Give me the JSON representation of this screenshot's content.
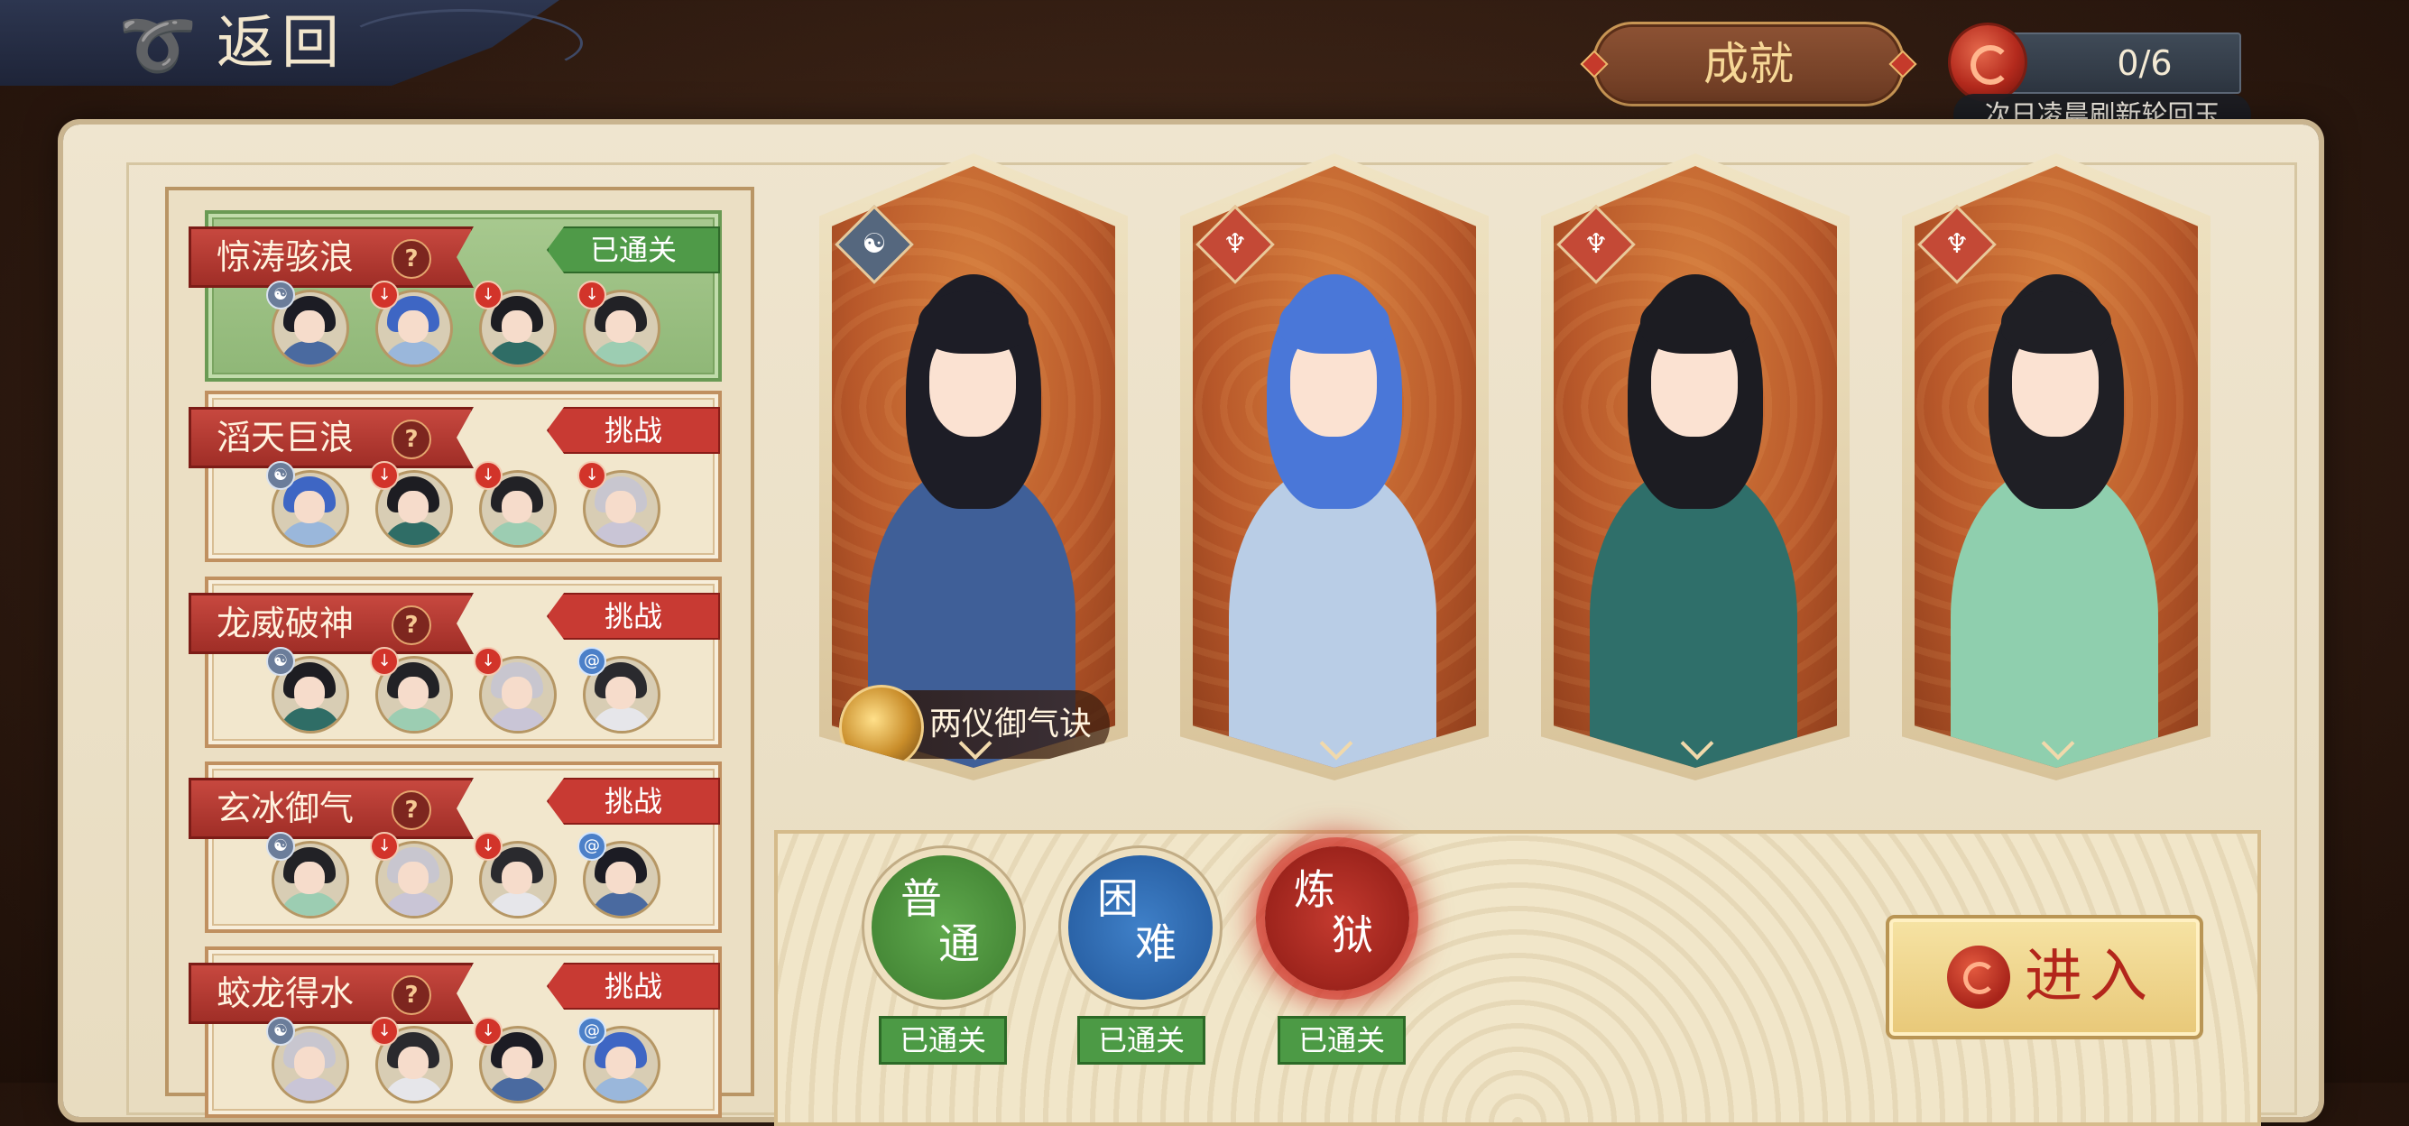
{
  "top_bar": {
    "back_label": "返回",
    "back_icon": "swirl-back-icon",
    "achievement_label": "成就",
    "jade_count": "0/6",
    "jade_icon": "reincarnation-jade-icon",
    "refresh_note": "次日凌晨刷新轮回玉"
  },
  "stages": [
    {
      "name": "惊涛骇浪",
      "status": "已通关",
      "status_type": "cleared",
      "lineup": [
        {
          "badge": "taiji"
        },
        {
          "badge": "sword"
        },
        {
          "badge": "sword"
        },
        {
          "badge": "sword"
        }
      ]
    },
    {
      "name": "滔天巨浪",
      "status": "挑战",
      "status_type": "challenge",
      "lineup": [
        {
          "badge": "taiji"
        },
        {
          "badge": "sword"
        },
        {
          "badge": "sword"
        },
        {
          "badge": "sword"
        }
      ]
    },
    {
      "name": "龙威破神",
      "status": "挑战",
      "status_type": "challenge",
      "lineup": [
        {
          "badge": "taiji"
        },
        {
          "badge": "sword"
        },
        {
          "badge": "sword"
        },
        {
          "badge": "spiral"
        }
      ]
    },
    {
      "name": "玄冰御气",
      "status": "挑战",
      "status_type": "challenge",
      "lineup": [
        {
          "badge": "taiji"
        },
        {
          "badge": "sword"
        },
        {
          "badge": "sword"
        },
        {
          "badge": "spiral"
        }
      ]
    },
    {
      "name": "蛟龙得水",
      "status": "挑战",
      "status_type": "challenge",
      "lineup": [
        {
          "badge": "taiji"
        },
        {
          "badge": "sword"
        },
        {
          "badge": "sword"
        },
        {
          "badge": "spiral"
        }
      ]
    }
  ],
  "characters": [
    {
      "role": "taiji",
      "role_glyph": "☯",
      "skill": "两仪御气诀",
      "colors": {
        "hair": "#1d1d26",
        "body": "#3f5f98"
      }
    },
    {
      "role": "sword",
      "role_glyph": "♆",
      "colors": {
        "hair": "#4a77d8",
        "body": "#b9cde6"
      }
    },
    {
      "role": "sword",
      "role_glyph": "♆",
      "colors": {
        "hair": "#1c1c22",
        "body": "#2f6f6a"
      }
    },
    {
      "role": "sword",
      "role_glyph": "♆",
      "colors": {
        "hair": "#1f1f25",
        "body": "#8fcfae"
      }
    }
  ],
  "difficulties": [
    {
      "key": "normal",
      "chars": [
        "普",
        "通"
      ],
      "status": "已通关"
    },
    {
      "key": "hard",
      "chars": [
        "困",
        "难"
      ],
      "status": "已通关"
    },
    {
      "key": "hell",
      "chars": [
        "炼",
        "狱"
      ],
      "status": "已通关"
    }
  ],
  "enter_label": "进入",
  "colors": {
    "cleared_green": "#4f9a48",
    "challenge_red": "#c83a33",
    "card_orange": "#b8582a",
    "paper": "#efe5cf"
  }
}
